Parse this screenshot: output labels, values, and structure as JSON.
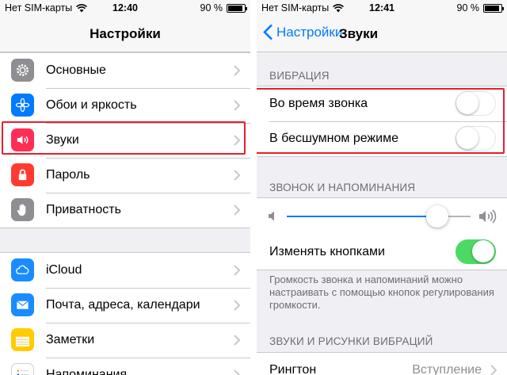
{
  "left_screen": {
    "status": {
      "carrier": "Нет SIM-карты",
      "time": "12:40",
      "battery": "90 %",
      "battery_level": 0.9
    },
    "nav_title": "Настройки",
    "group1": [
      {
        "label": "Основные",
        "icon": "gear-icon",
        "color": "#8e8e93"
      },
      {
        "label": "Обои и яркость",
        "icon": "flower-icon",
        "color": "#007aff"
      },
      {
        "label": "Звуки",
        "icon": "speaker-icon",
        "color": "#ff2d55"
      },
      {
        "label": "Пароль",
        "icon": "lock-icon",
        "color": "#ff3b30"
      },
      {
        "label": "Приватность",
        "icon": "hand-icon",
        "color": "#8e8e93"
      }
    ],
    "group2": [
      {
        "label": "iCloud",
        "icon": "cloud-icon",
        "color": "#1a8cff"
      },
      {
        "label": "Почта, адреса, календари",
        "icon": "mail-icon",
        "color": "#1a8cff"
      },
      {
        "label": "Заметки",
        "icon": "notes-icon",
        "color": "#ffcc00"
      },
      {
        "label": "Напоминания",
        "icon": "list-icon",
        "color": "#ffffff"
      }
    ]
  },
  "right_screen": {
    "status": {
      "carrier": "Нет SIM-карты",
      "time": "12:41",
      "battery": "90 %",
      "battery_level": 0.9
    },
    "back_label": "Настройки",
    "nav_title": "Звуки",
    "vibration_header": "ВИБРАЦИЯ",
    "vibration_rows": [
      {
        "label": "Во время звонка",
        "on": false
      },
      {
        "label": "В бесшумном режиме",
        "on": false
      }
    ],
    "ringer_header": "ЗВОНОК И НАПОМИНАНИЯ",
    "volume_level": 0.82,
    "change_with_buttons": {
      "label": "Изменять кнопками",
      "on": true
    },
    "footnote": "Громкость звонка и напоминаний можно настраивать с помощью кнопок регулирования громкости.",
    "patterns_header": "ЗВУКИ И РИСУНКИ ВИБРАЦИЙ",
    "ringtone": {
      "label": "Рингтон",
      "value": "Вступление"
    }
  },
  "colors": {
    "accent": "#007aff",
    "switch_on": "#4cd964",
    "highlight": "#e5202c"
  }
}
